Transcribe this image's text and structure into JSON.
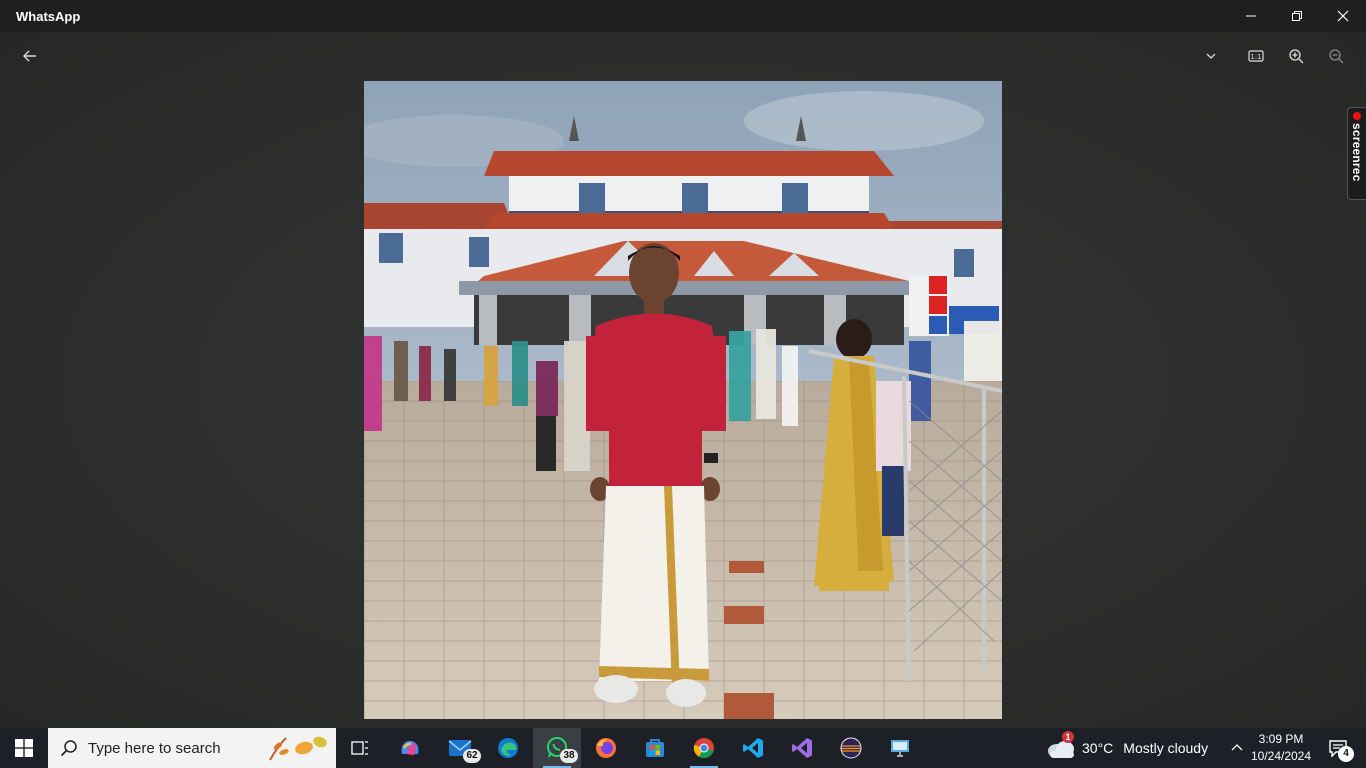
{
  "window": {
    "title": "WhatsApp"
  },
  "viewer": {
    "zoom_reset_label": "1:1",
    "photo_description_name": "photo"
  },
  "screenrec": {
    "label": "screenrec"
  },
  "taskbar": {
    "search_placeholder": "Type here to search",
    "mail_badge": "62",
    "whatsapp_badge": "38",
    "weather": {
      "temp": "30°C",
      "desc": "Mostly cloudy",
      "alert_count": "1"
    },
    "clock": {
      "time": "3:09 PM",
      "date": "10/24/2024"
    },
    "notifications_count": "4"
  },
  "colors": {
    "titlebar": "#1f1f1f",
    "taskbar": "#1d2127",
    "accent": "#76b9ed"
  }
}
